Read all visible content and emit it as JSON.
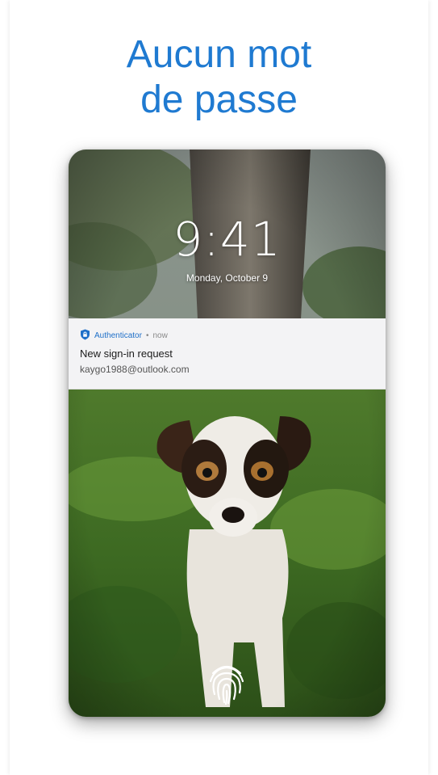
{
  "headline": {
    "line1": "Aucun mot",
    "line2": "de passe"
  },
  "lockscreen": {
    "time": "9:41",
    "date": "Monday, October 9"
  },
  "notification": {
    "app_name": "Authenticator",
    "separator": "•",
    "when": "now",
    "title": "New sign-in request",
    "account": "kaygo1988@outlook.com"
  },
  "icons": {
    "app": "lock-shield-icon",
    "unlock": "fingerprint-icon"
  },
  "colors": {
    "accent": "#1f7ad1",
    "app_name": "#1e6fc8",
    "notification_bg": "#f3f3f5"
  }
}
